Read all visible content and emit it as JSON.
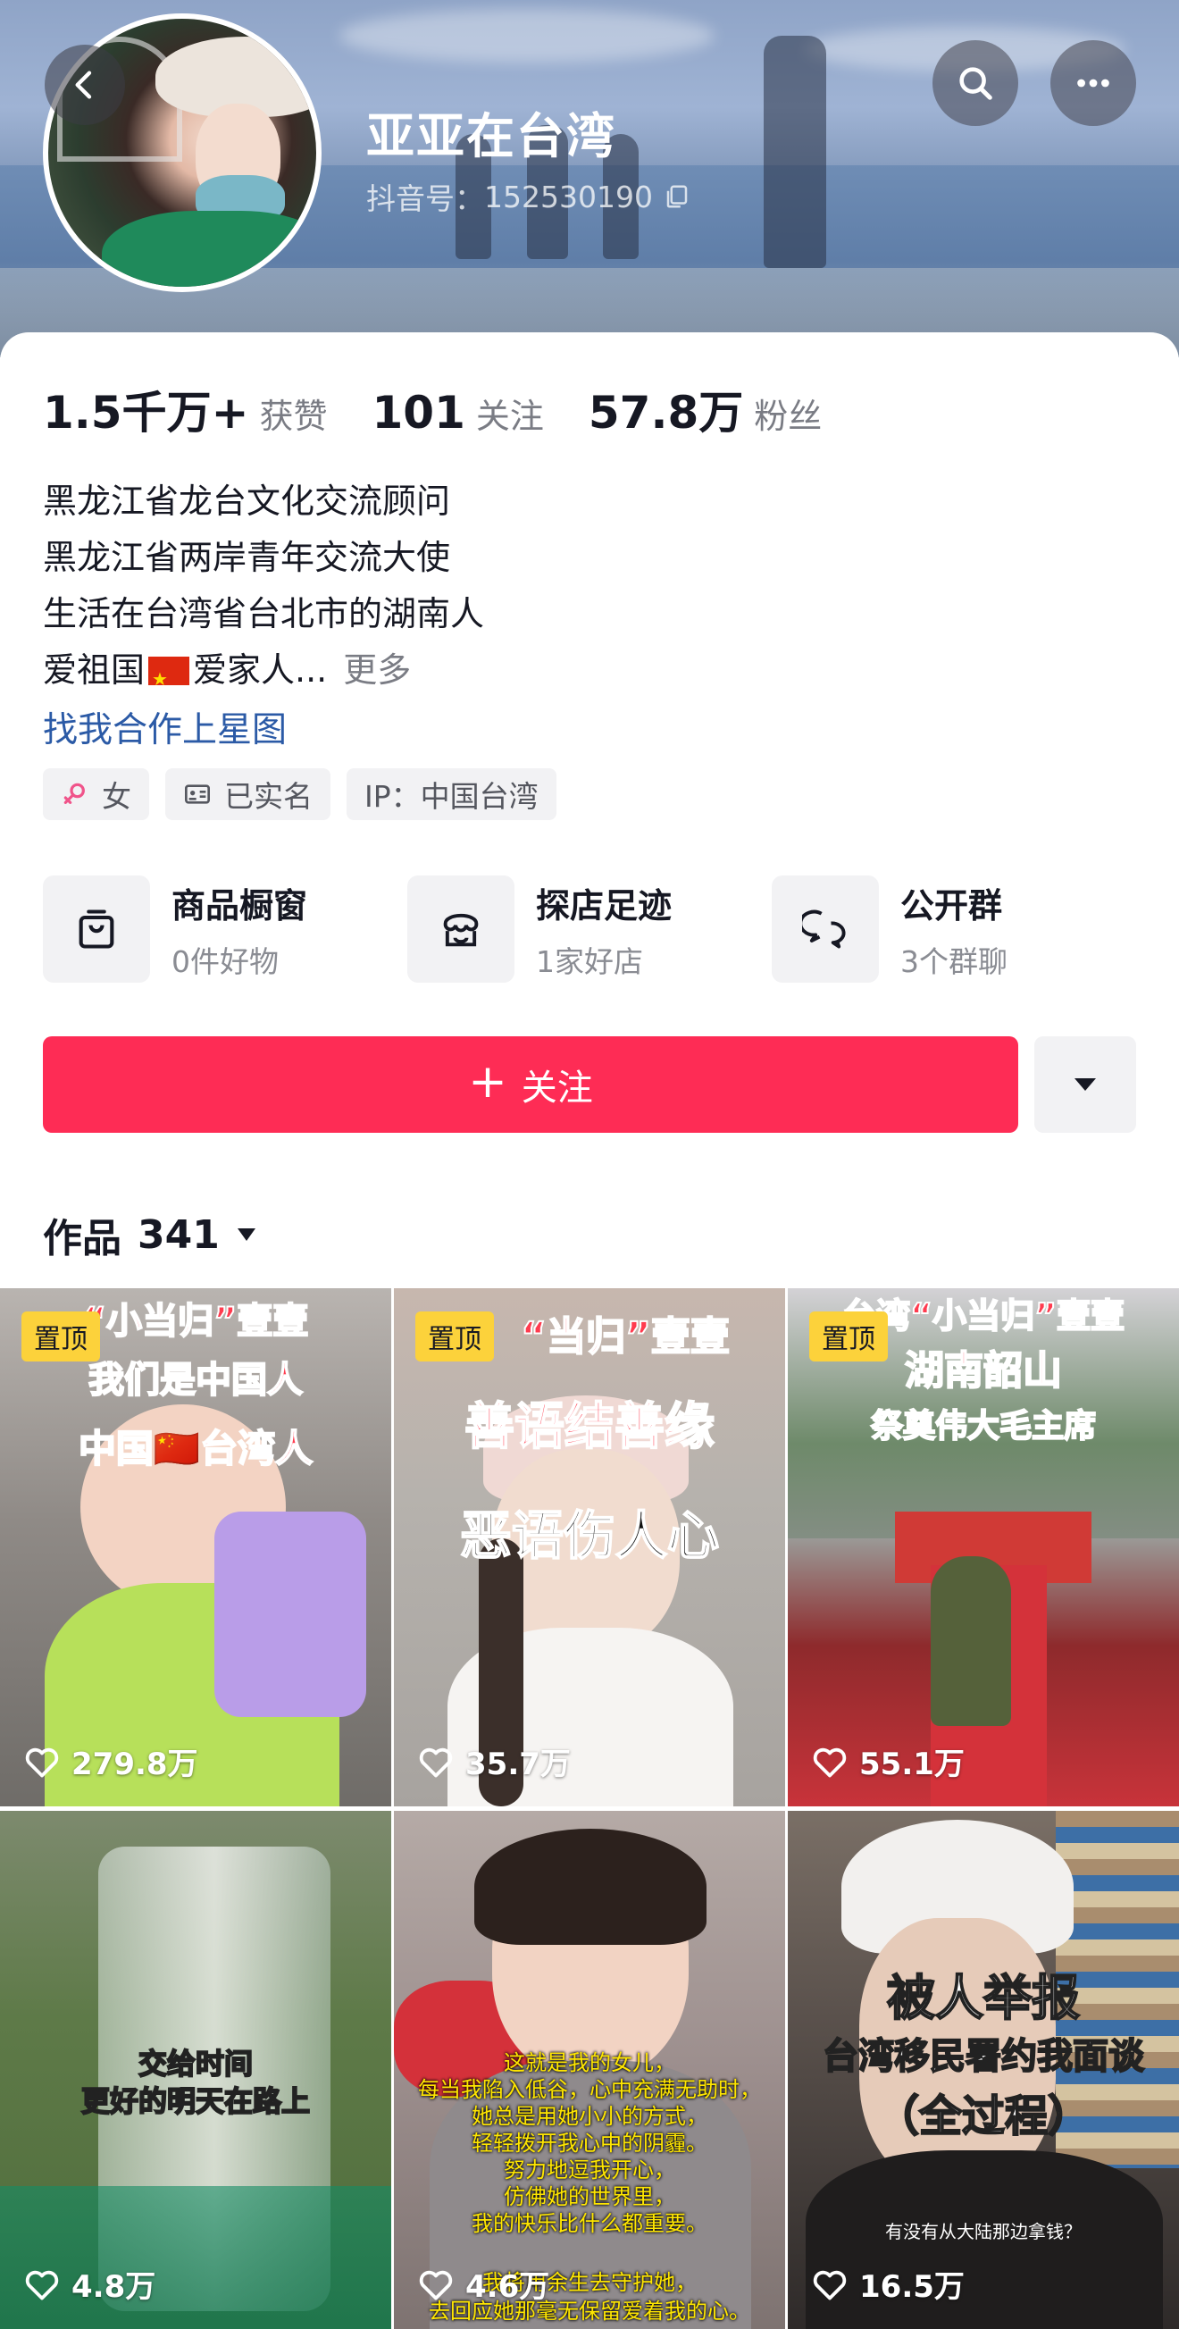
{
  "header": {
    "nickname": "亚亚在台湾",
    "douyin_id_label": "抖音号：",
    "douyin_id": "152530190"
  },
  "stats": [
    {
      "value": "1.5千万+",
      "label": "获赞"
    },
    {
      "value": "101",
      "label": "关注"
    },
    {
      "value": "57.8万",
      "label": "粉丝"
    }
  ],
  "bio": {
    "lines": [
      "黑龙江省龙台文化交流顾问",
      "黑龙江省两岸青年交流大使",
      "生活在台湾省台北市的湖南人"
    ],
    "line4_a": "爱祖国",
    "line4_b": "爱家人...",
    "more": "更多",
    "link": "找我合作上星图"
  },
  "tags": [
    {
      "icon": "female-icon",
      "label": "女"
    },
    {
      "icon": "id-card-icon",
      "label": "已实名"
    },
    {
      "icon": "",
      "label": "IP：中国台湾"
    }
  ],
  "shortcuts": [
    {
      "icon": "shopping-bag-icon",
      "title": "商品橱窗",
      "sub": "0件好物"
    },
    {
      "icon": "store-icon",
      "title": "探店足迹",
      "sub": "1家好店"
    },
    {
      "icon": "chat-group-icon",
      "title": "公开群",
      "sub": "3个群聊"
    }
  ],
  "actions": {
    "follow_label": "关注"
  },
  "works": {
    "label": "作品",
    "count": "341"
  },
  "videos": [
    {
      "pinned": "置顶",
      "likes": "279.8万",
      "captions": [
        "“小当归”壹壹",
        "我们是中国人",
        "中国🇨🇳台湾人"
      ]
    },
    {
      "pinned": "置顶",
      "likes": "35.7万",
      "captions": [
        "“当归”壹壹",
        "善语结善缘",
        "恶语伤人心"
      ]
    },
    {
      "pinned": "置顶",
      "likes": "55.1万",
      "captions": [
        "台湾“小当归”壹壹",
        "湖南韶山",
        "祭奠伟大毛主席"
      ]
    },
    {
      "pinned": "",
      "likes": "4.8万",
      "captions": [
        "交给时间",
        "更好的明天在路上"
      ]
    },
    {
      "pinned": "",
      "likes": "4.6万",
      "captions": [
        "这就是我的女儿，",
        "每当我陷入低谷，心中充满无助时，",
        "她总是用她小小的方式，",
        "轻轻拨开我心中的阴霾。",
        "努力地逗我开心，",
        "仿佛她的世界里，",
        "我的快乐比什么都重要。",
        "我将用余生去守护她，",
        "去回应她那毫无保留爱着我的心。"
      ]
    },
    {
      "pinned": "",
      "likes": "16.5万",
      "captions": [
        "被人举报",
        "台湾移民署约我面谈",
        "（全过程）",
        "有没有从大陆那边拿钱？"
      ]
    }
  ]
}
